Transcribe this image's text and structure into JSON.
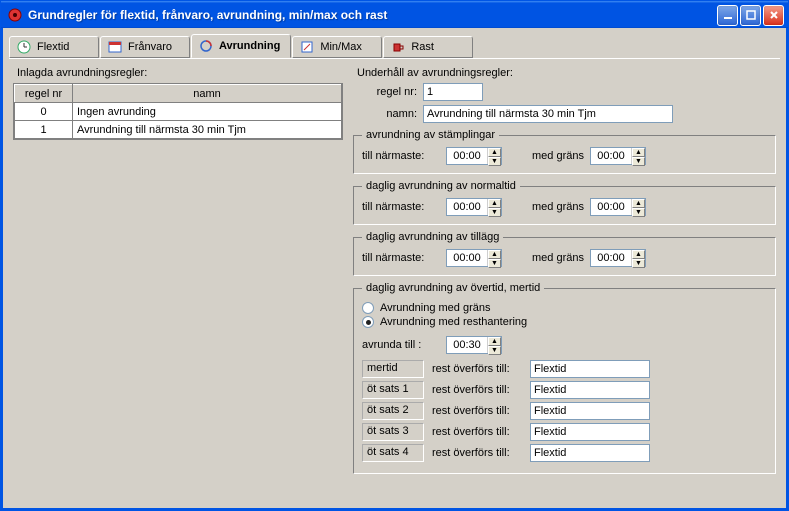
{
  "window": {
    "title": "Grundregler för flextid, frånvaro, avrundning, min/max och rast"
  },
  "tabs": {
    "flextid": "Flextid",
    "franvaro": "Frånvaro",
    "avrundning": "Avrundning",
    "minmax": "Min/Max",
    "rast": "Rast"
  },
  "left": {
    "heading": "Inlagda avrundningsregler:",
    "col_nr": "regel nr",
    "col_name": "namn",
    "rows": [
      {
        "nr": "0",
        "name": "Ingen avrunding"
      },
      {
        "nr": "1",
        "name": "Avrundning till närmsta 30 min Tjm"
      }
    ]
  },
  "right": {
    "heading": "Underhåll av avrundningsregler:",
    "regel_nr_label": "regel nr:",
    "regel_nr": "1",
    "namn_label": "namn:",
    "namn": "Avrundning till närmsta 30 min Tjm",
    "group_stampling": "avrundning av stämplingar",
    "group_normal": "daglig avrundning av normaltid",
    "group_tillagg": "daglig avrundning av tillägg",
    "group_overtid": "daglig avrundning av övertid, mertid",
    "till_narmaste": "till närmaste:",
    "med_grans": "med gräns",
    "stampling_near": "00:00",
    "stampling_limit": "00:00",
    "normal_near": "00:00",
    "normal_limit": "00:00",
    "tillagg_near": "00:00",
    "tillagg_limit": "00:00",
    "radio_grans": "Avrundning med gräns",
    "radio_rest": "Avrundning med resthantering",
    "avrunda_till_label": "avrunda till :",
    "avrunda_till": "00:30",
    "rest_overfors": "rest överförs till:",
    "dest": {
      "mertid": {
        "src": "mertid",
        "target": "Flextid"
      },
      "ot1": {
        "src": "öt sats 1",
        "target": "Flextid"
      },
      "ot2": {
        "src": "öt sats 2",
        "target": "Flextid"
      },
      "ot3": {
        "src": "öt sats 3",
        "target": "Flextid"
      },
      "ot4": {
        "src": "öt sats 4",
        "target": "Flextid"
      }
    }
  }
}
